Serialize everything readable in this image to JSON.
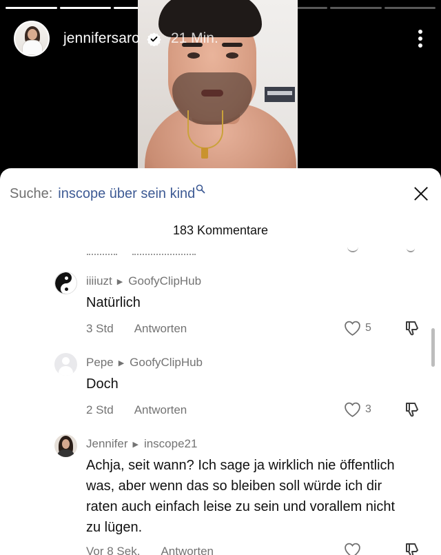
{
  "story": {
    "username": "jennifersaro",
    "time": "21 Min.",
    "segments_total": 8,
    "segments_done": 5
  },
  "sheet": {
    "search_prefix": "Suche:",
    "search_query": "inscope über sein kind",
    "comment_count": "183 Kommentare"
  },
  "comments": [
    {
      "author": "iiiiuzt",
      "reply_to": "GoofyClipHub",
      "text": "Natürlich",
      "time": "3 Std",
      "reply_label": "Antworten",
      "likes": "5"
    },
    {
      "author": "Pepe",
      "reply_to": "GoofyClipHub",
      "text": "Doch",
      "time": "2 Std",
      "reply_label": "Antworten",
      "likes": "3"
    },
    {
      "author": "Jennifer",
      "reply_to": "inscope21",
      "text": "Achja, seit wann? Ich sage ja wirklich nie öffentlich was, aber wenn das so bleiben soll würde ich dir raten auch einfach leise zu sein und vorallem nicht zu lügen.",
      "time": "Vor 8 Sek.",
      "reply_label": "Antworten",
      "likes": ""
    }
  ]
}
